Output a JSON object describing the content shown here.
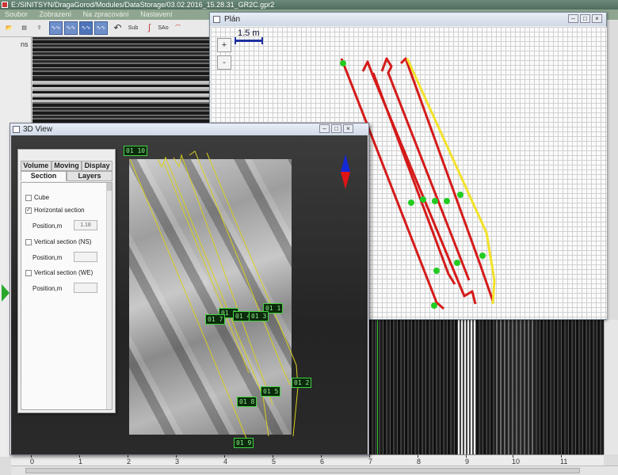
{
  "app": {
    "title": "E:/SINITSYN/DragaGorod/Modules/DataStorage/03.02.2016_15.28.31_GR2C.gpr2",
    "menu": [
      "Soubor",
      "Zobrazení",
      "Na zpracování",
      "Nastavení"
    ]
  },
  "toolbar": {
    "buttons": [
      {
        "icon": "open-folder-icon",
        "label": ""
      },
      {
        "icon": "save-icon",
        "label": ""
      },
      {
        "icon": "export-icon",
        "label": ""
      },
      {
        "icon": "wave-icon",
        "label": ""
      },
      {
        "icon": "wave-icon",
        "label": ""
      },
      {
        "icon": "wave-active-icon",
        "label": ""
      },
      {
        "icon": "wave-icon",
        "label": ""
      },
      {
        "icon": "undo-icon",
        "label": ""
      },
      {
        "icon": "text-tool",
        "label": "Sub"
      },
      {
        "icon": "curve-icon",
        "label": ""
      },
      {
        "icon": "text-tool",
        "label": "SAo"
      },
      {
        "icon": "antenna-icon",
        "label": ""
      }
    ]
  },
  "radargram": {
    "unit_label": "ns",
    "zero_label": "0",
    "x_ticks": [
      "0",
      "1",
      "2",
      "3",
      "4",
      "5",
      "6",
      "7",
      "8",
      "9",
      "10",
      "11"
    ]
  },
  "plan": {
    "title": "Plán",
    "scale_label": "1.5 m",
    "zoom_in": "+",
    "zoom_out": "-",
    "colors": {
      "route": "#d51a1a",
      "selected_route": "#f2e22a",
      "marker": "#22cc22",
      "grid": "#d0d0d0"
    }
  },
  "view3d": {
    "title": "3D View",
    "labels": [
      "01 10",
      "01 1",
      "01 6",
      "01 4",
      "01 3",
      "01 7",
      "01 5",
      "01 2",
      "01 8",
      "01 9"
    ],
    "colors": {
      "axis_up": "#1428d8",
      "axis_down": "#e01414",
      "track": "#d8d020",
      "label_bg": "#0c2a0c",
      "label_border": "#3fd23f"
    }
  },
  "panel": {
    "tabs_row1": [
      "Volume",
      "Moving",
      "Display"
    ],
    "tabs_row2": [
      "Section",
      "Layers"
    ],
    "active_tab": "Section",
    "cube_label": "Cube",
    "horizontal_label": "Horizontal section",
    "horizontal_checked": true,
    "horizontal_position_label": "Position,m",
    "horizontal_position_value": "1.18",
    "vertical_ns_label": "Vertical section (NS)",
    "vertical_ns_position_label": "Position,m",
    "vertical_we_label": "Vertical section (WE)",
    "vertical_we_position_label": "Position,m"
  },
  "window_buttons": {
    "minimize": "–",
    "maximize": "□",
    "close": "×"
  }
}
